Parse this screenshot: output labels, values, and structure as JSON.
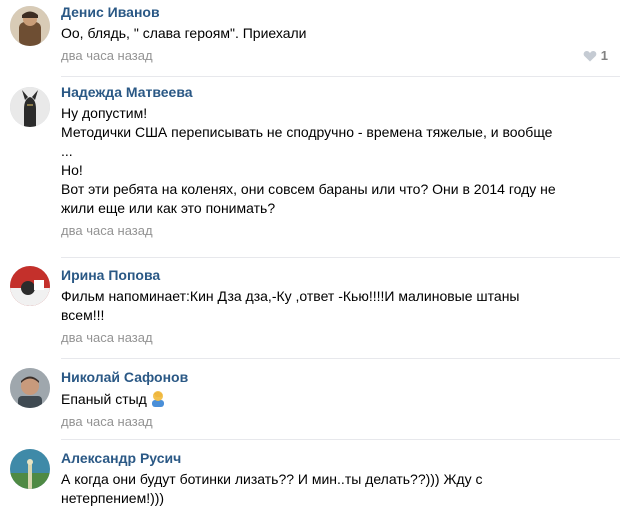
{
  "comments": [
    {
      "author": "Денис Иванов",
      "lines": [
        "Оо, блядь, \" слава героям\". Приехали"
      ],
      "date": "два часа назад",
      "likes": "1"
    },
    {
      "author": "Надежда Матвеева",
      "lines": [
        "Ну допустим!",
        "Методички США переписывать не сподручно - времена тяжелые, и вообще",
        "...",
        "Но!",
        "Вот эти ребята на коленях, они совсем бараны или что? Они в 2014 году не",
        "жили еще или как это понимать?"
      ],
      "date": "два часа назад"
    },
    {
      "author": "Ирина Попова",
      "lines": [
        "Фильм напоминает:Кин Дза дза,-Ку ,ответ -Кью!!!!И малиновые штаны",
        "всем!!!"
      ],
      "date": "два часа назад"
    },
    {
      "author": "Николай Сафонов",
      "lines": [
        "Епаный стыд"
      ],
      "emoji": "person-facepalm-emoji",
      "date": "два часа назад"
    },
    {
      "author": "Александр Русич",
      "lines": [
        "А когда они будут ботинки лизать?? И мин..ты делать??))) Жду с",
        "нетерпением!)))"
      ]
    }
  ],
  "icons": {
    "like": "heart-icon"
  },
  "colors": {
    "author": "#2a5885",
    "meta": "#939393",
    "divider": "#e7e8ec"
  }
}
